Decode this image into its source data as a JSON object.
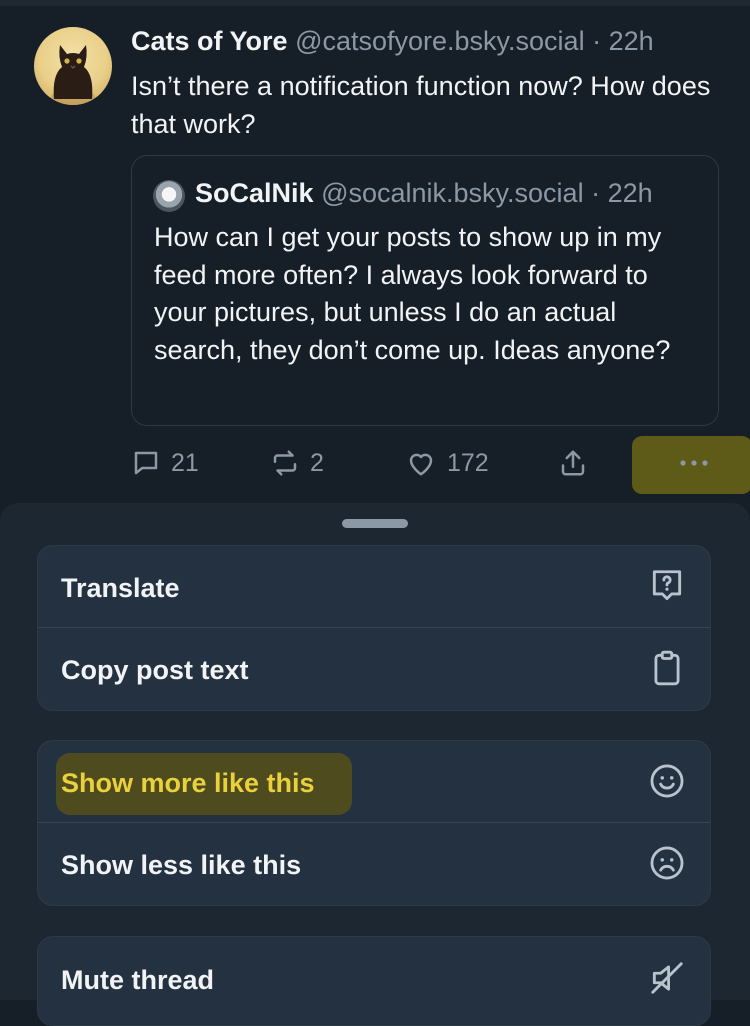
{
  "post": {
    "author_name": "Cats of Yore",
    "author_handle": "@catsofyore.bsky.social",
    "time": "· 22h",
    "text": "Isn’t there a notification function now? How does that work?",
    "quote": {
      "author_name": "SoCalNik",
      "author_handle": "@socalnik.bsky.social",
      "time": "· 22h",
      "text": "How can I get your posts to show up in my feed more often? I always look forward to your pictures, but unless I do an actual search, they don’t come up. Ideas anyone?"
    },
    "actions": {
      "replies": "21",
      "reposts": "2",
      "likes": "172"
    }
  },
  "menu": {
    "group1": [
      {
        "label": "Translate",
        "icon": "translate-icon"
      },
      {
        "label": "Copy post text",
        "icon": "clipboard-icon"
      }
    ],
    "group2": [
      {
        "label": "Show more like this",
        "icon": "smile-icon"
      },
      {
        "label": "Show less like this",
        "icon": "frown-icon"
      }
    ],
    "group3": [
      {
        "label": "Mute thread",
        "icon": "mute-icon"
      }
    ]
  },
  "colors": {
    "background": "#161e27",
    "sheet": "#1c2732",
    "highlight": "#ead03b",
    "muted": "#8b98a5"
  }
}
